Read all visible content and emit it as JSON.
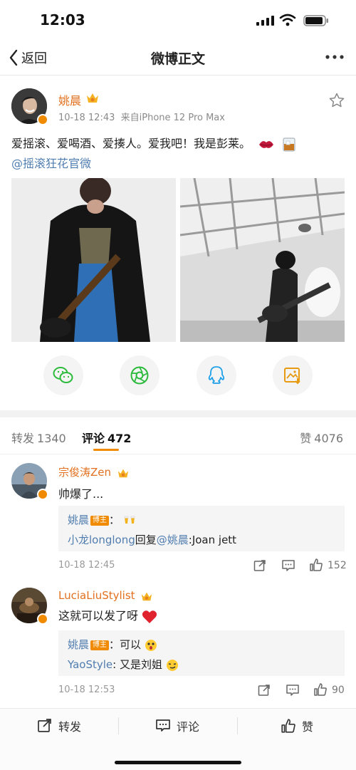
{
  "status_bar": {
    "time": "12:03"
  },
  "nav": {
    "back_label": "返回",
    "title": "微博正文"
  },
  "post": {
    "author": "姚晨",
    "time": "10-18 12:43",
    "source": "来自iPhone 12 Pro Max",
    "text": "爱摇滚、爱喝酒、爱揍人。爱我吧！我是彭莱。",
    "mention": "@摇滚狂花官微",
    "emoji_icons": [
      "lips-emoji-icon",
      "whiskey-glass-emoji-icon"
    ]
  },
  "share_icons": [
    "wechat-icon",
    "moments-icon",
    "qq-icon",
    "save-image-icon"
  ],
  "tabs": {
    "repost": {
      "label": "转发",
      "count": "1340"
    },
    "comment": {
      "label": "评论",
      "count": "472"
    },
    "like": {
      "label": "赞",
      "count": "4076"
    }
  },
  "comments": [
    {
      "name": "宗俊涛Zen",
      "text": "帅爆了...",
      "replies": [
        {
          "name": "姚晨",
          "tag": "博主",
          "text": "："
        },
        {
          "name": "小龙longlong",
          "mid": "回复",
          "mention": "@姚晨",
          "text": ":Joan jett"
        }
      ],
      "time": "10-18 12:45",
      "likes": "152"
    },
    {
      "name": "LuciaLiuStylist",
      "text": "这就可以发了呀",
      "replies": [
        {
          "name": "姚晨",
          "tag": "博主",
          "text": "：可以"
        },
        {
          "name": "YaoStyle",
          "text": ": 又是刘姐"
        }
      ],
      "time": "10-18 12:53",
      "likes": "90"
    }
  ],
  "bottom_bar": {
    "repost": "转发",
    "comment": "评论",
    "like": "赞"
  },
  "colors": {
    "accent_orange": "#f08a00",
    "name_orange": "#e2701f",
    "link_blue": "#507daf"
  }
}
